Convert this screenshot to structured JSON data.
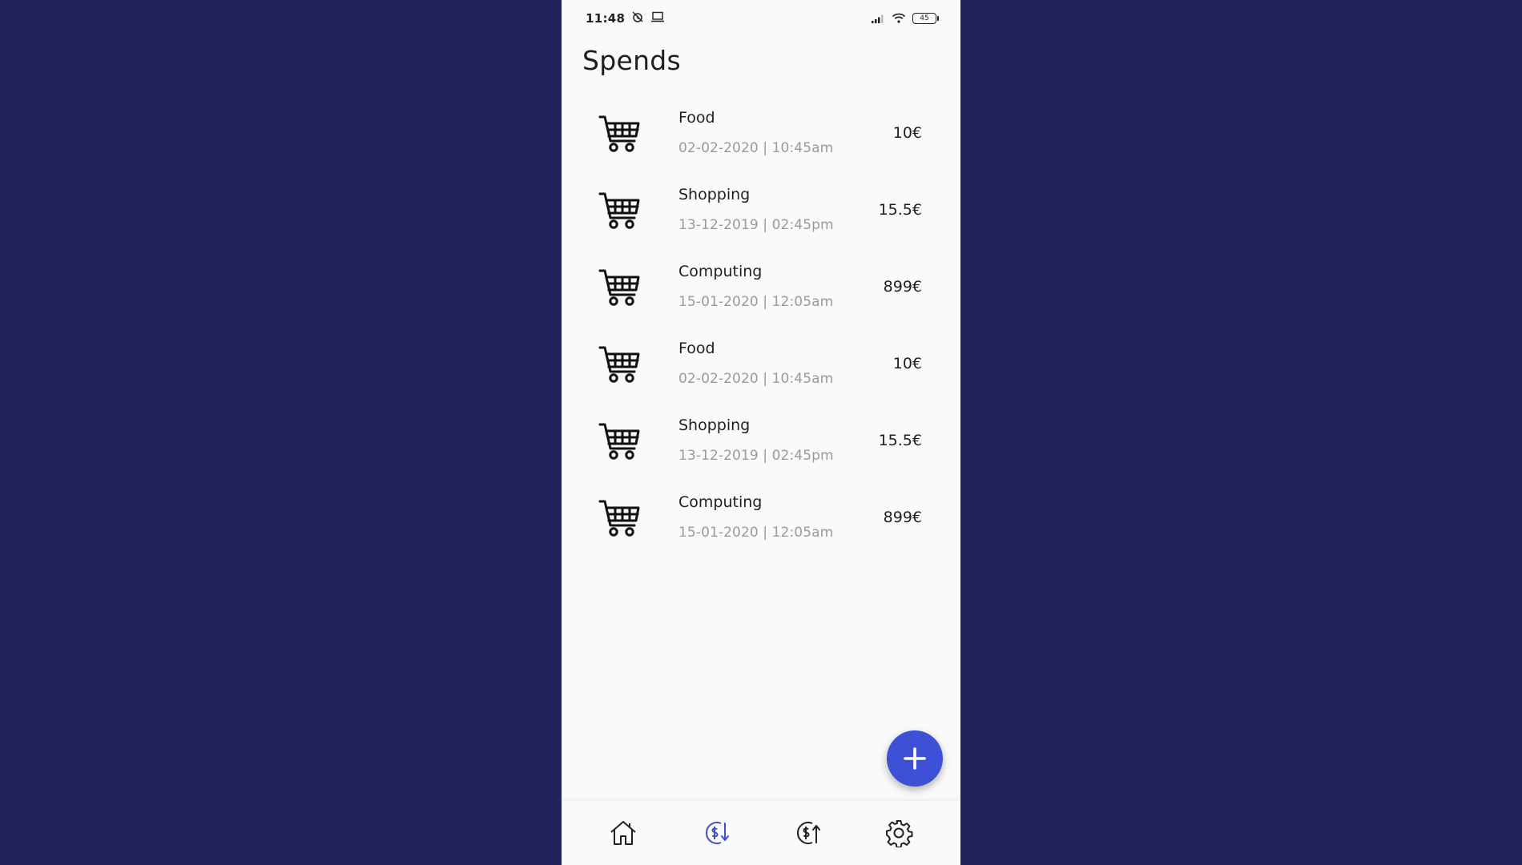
{
  "status_bar": {
    "time": "11:48",
    "battery": "45",
    "icons": [
      "alarm-off-icon",
      "laptop-icon",
      "signal-icon",
      "wifi-icon",
      "battery-icon"
    ]
  },
  "page": {
    "title": "Spends"
  },
  "spends": [
    {
      "name": "Food",
      "date": "02-02-2020 | 10:45am",
      "amount": "10€",
      "icon": "shopping-cart-icon"
    },
    {
      "name": "Shopping",
      "date": "13-12-2019 | 02:45pm",
      "amount": "15.5€",
      "icon": "shopping-cart-icon"
    },
    {
      "name": "Computing",
      "date": "15-01-2020 | 12:05am",
      "amount": "899€",
      "icon": "shopping-cart-icon"
    },
    {
      "name": "Food",
      "date": "02-02-2020 | 10:45am",
      "amount": "10€",
      "icon": "shopping-cart-icon"
    },
    {
      "name": "Shopping",
      "date": "13-12-2019 | 02:45pm",
      "amount": "15.5€",
      "icon": "shopping-cart-icon"
    },
    {
      "name": "Computing",
      "date": "15-01-2020 | 12:05am",
      "amount": "899€",
      "icon": "shopping-cart-icon"
    }
  ],
  "fab": {
    "icon": "plus-icon"
  },
  "bottom_nav": {
    "items": [
      {
        "icon": "home-icon",
        "active": false
      },
      {
        "icon": "spends-icon",
        "active": true
      },
      {
        "icon": "incomes-icon",
        "active": false
      },
      {
        "icon": "settings-icon",
        "active": false
      }
    ]
  },
  "colors": {
    "background": "#20245a",
    "screen": "#fafafa",
    "accent": "#3e50d6",
    "text": "#1f1f1f",
    "muted": "#9a9a9a"
  }
}
